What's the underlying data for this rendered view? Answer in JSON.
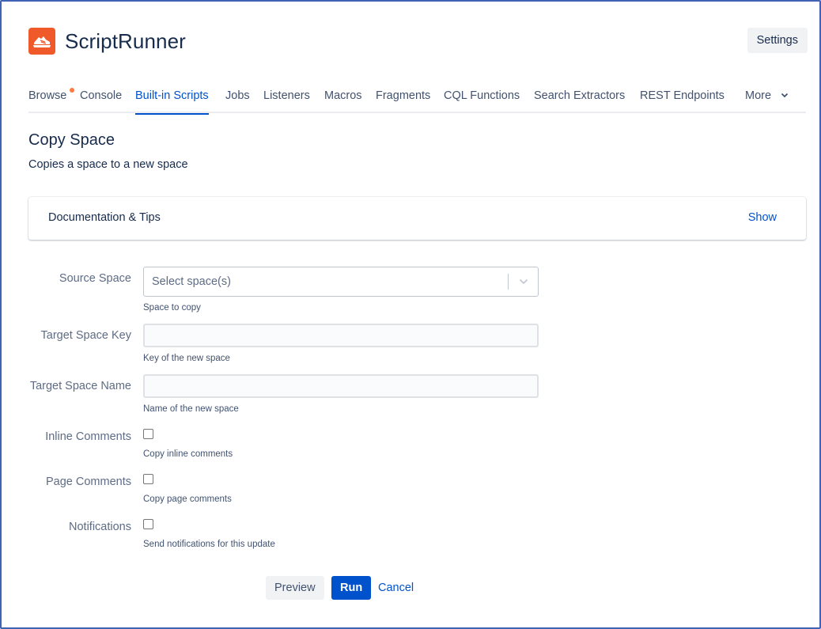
{
  "app": {
    "title": "ScriptRunner",
    "settings_label": "Settings",
    "logo_icon": "sneaker-logo-icon",
    "brand_color": "#f05a2b"
  },
  "tabs": [
    {
      "label": "Browse",
      "active": false,
      "has_dot": true
    },
    {
      "label": "Console",
      "active": false
    },
    {
      "label": "Built-in Scripts",
      "active": true
    },
    {
      "label": "Jobs",
      "active": false
    },
    {
      "label": "Listeners",
      "active": false
    },
    {
      "label": "Macros",
      "active": false
    },
    {
      "label": "Fragments",
      "active": false
    },
    {
      "label": "CQL Functions",
      "active": false
    },
    {
      "label": "Search Extractors",
      "active": false
    },
    {
      "label": "REST Endpoints",
      "active": false
    },
    {
      "label": "More",
      "active": false,
      "dropdown": true
    }
  ],
  "page": {
    "title": "Copy Space",
    "description": "Copies a space to a new space"
  },
  "docs": {
    "title": "Documentation & Tips",
    "toggle_label": "Show"
  },
  "form": {
    "source_space": {
      "label": "Source Space",
      "placeholder": "Select space(s)",
      "hint": "Space to copy"
    },
    "target_key": {
      "label": "Target Space Key",
      "value": "",
      "hint": "Key of the new space"
    },
    "target_name": {
      "label": "Target Space Name",
      "value": "",
      "hint": "Name of the new space"
    },
    "inline_comments": {
      "label": "Inline Comments",
      "checked": false,
      "hint": "Copy inline comments"
    },
    "page_comments": {
      "label": "Page Comments",
      "checked": false,
      "hint": "Copy page comments"
    },
    "notifications": {
      "label": "Notifications",
      "checked": false,
      "hint": "Send notifications for this update"
    }
  },
  "actions": {
    "preview_label": "Preview",
    "run_label": "Run",
    "cancel_label": "Cancel"
  },
  "colors": {
    "accent": "#0052cc",
    "tab_dot": "#ff7a3d"
  }
}
